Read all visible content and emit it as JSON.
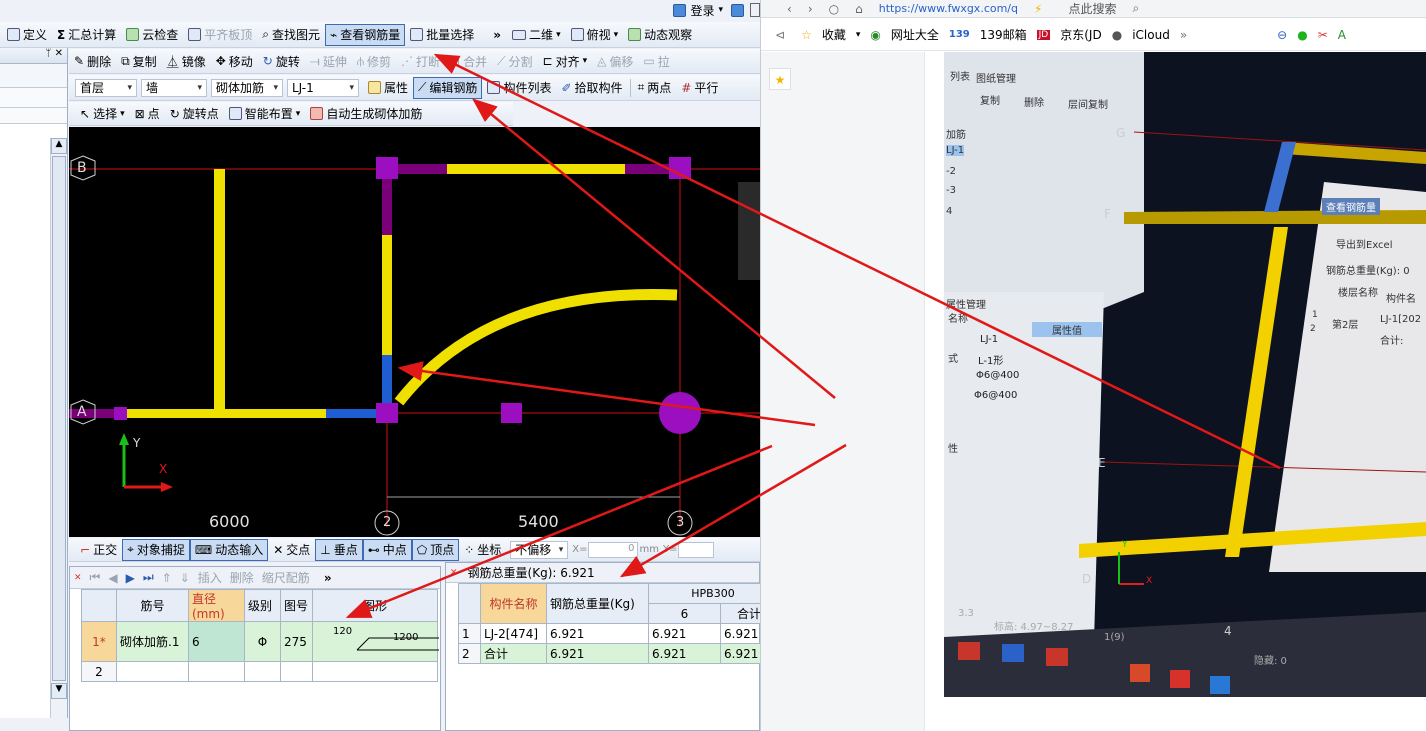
{
  "top_bar": {
    "login": "登录"
  },
  "toolbar1": {
    "items": [
      "定义",
      "汇总计算",
      "云检查",
      "平齐板顶",
      "查找图元",
      "查看钢筋量",
      "批量选择"
    ],
    "view_2d": "二维",
    "view_top": "俯视",
    "dynamic": "动态观察"
  },
  "toolbar2": {
    "items": [
      "删除",
      "复制",
      "镜像",
      "移动",
      "旋转",
      "延伸",
      "修剪",
      "打断",
      "合并",
      "分割",
      "对齐",
      "偏移",
      "拉"
    ]
  },
  "toolbar3": {
    "floor": "首层",
    "type": "墙",
    "sub": "砌体加筋",
    "name": "LJ-1",
    "items": [
      "属性",
      "编辑钢筋",
      "构件列表",
      "拾取构件",
      "两点",
      "平行"
    ]
  },
  "toolbar4": {
    "items": [
      "选择",
      "点",
      "旋转点",
      "智能布置",
      "自动生成砌体加筋"
    ]
  },
  "canvas": {
    "axis_a": "A",
    "axis_b": "B",
    "axis_2": "2",
    "axis_3": "3",
    "dim_1": "6000",
    "dim_2": "5400",
    "y_label": "Y",
    "x_label": "X"
  },
  "snapbar": {
    "items": [
      "正交",
      "对象捕捉",
      "动态输入",
      "交点",
      "垂点",
      "中点",
      "顶点",
      "坐标"
    ],
    "offset": "不偏移",
    "x_label": "X=",
    "x_val": "0",
    "unit": "mm",
    "y_label": "Y="
  },
  "rebar_toolbar": {
    "items": [
      "插入",
      "删除",
      "缩尺配筋"
    ]
  },
  "rebar_table": {
    "headers": [
      "筋号",
      "直径(mm)",
      "级别",
      "图号",
      "图形"
    ],
    "rows": [
      {
        "idx": "1*",
        "name": "砌体加筋.1",
        "dia": "6",
        "grade": "Φ",
        "fig": "275",
        "shape_a": "120",
        "shape_b": "1200"
      },
      {
        "idx": "2",
        "name": "",
        "dia": "",
        "grade": "",
        "fig": "",
        "shape_a": "",
        "shape_b": ""
      }
    ]
  },
  "weight": {
    "title": "钢筋总重量(Kg): 6.921",
    "headers": [
      "构件名称",
      "钢筋总重量(Kg)",
      "HPB300",
      "6",
      "合计"
    ],
    "rows": [
      {
        "idx": "1",
        "name": "LJ-2[474]",
        "total": "6.921",
        "d6": "6.921",
        "sum": "6.921"
      },
      {
        "idx": "2",
        "name": "合计",
        "total": "6.921",
        "d6": "6.921",
        "sum": "6.921"
      }
    ]
  },
  "browser": {
    "url": "https://www.fwxgx.com/q",
    "search": "点此搜索",
    "bookmarks": [
      "收藏",
      "网址大全",
      "139邮箱",
      "京东(JD",
      "iCloud"
    ]
  },
  "photo": {
    "tab1": "列表",
    "tab2": "图纸管理",
    "copy": "复制",
    "delete": "删除",
    "layer_copy": "层间复制",
    "list_head": "加筋",
    "list_items": [
      "LJ-1",
      "-2",
      "-3",
      "4"
    ],
    "prop_title": "属性管理",
    "prop_header": "属性值",
    "prop_name": "名称",
    "prop_form": "式",
    "prop_other": "性",
    "prop_vals": [
      "LJ-1",
      "L-1形",
      "Φ6@400",
      "Φ6@400"
    ],
    "axes": [
      "G",
      "F",
      "E",
      "D",
      "4"
    ],
    "dialog_title": "查看钢筋量",
    "export": "导出到Excel",
    "total_label": "钢筋总重量(Kg): 0",
    "col_floor": "楼层名称",
    "col_comp": "构件名",
    "row_floor": "第2层",
    "row_comp": "LJ-1[202",
    "row_sum": "合计:",
    "status": "标高: 4.97~8.27",
    "page": "1(9)",
    "hidden": "隐藏: 0",
    "coord": "3.3",
    "xlbl": "X",
    "ylbl": "Y",
    "nums": [
      "1",
      "2"
    ]
  }
}
